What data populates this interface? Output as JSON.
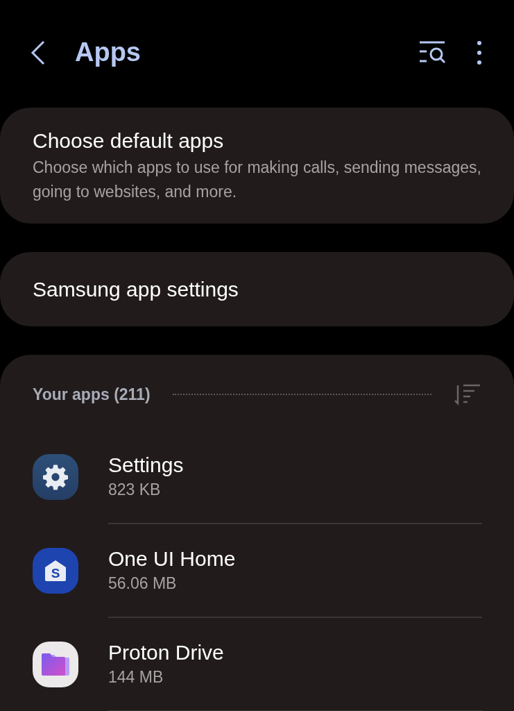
{
  "header": {
    "title": "Apps"
  },
  "cards": [
    {
      "title": "Choose default apps",
      "description": "Choose which apps to use for making calls, sending messages, going to websites, and more."
    },
    {
      "title": "Samsung app settings"
    }
  ],
  "apps_section": {
    "heading": "Your apps (211)",
    "apps": [
      {
        "kind": "gear",
        "name": "Settings",
        "size": "823 KB"
      },
      {
        "kind": "home",
        "name": "One UI Home",
        "size": "56.06 MB",
        "icon_letter": "S"
      },
      {
        "kind": "folder",
        "name": "Proton Drive",
        "size": "144 MB"
      }
    ]
  }
}
